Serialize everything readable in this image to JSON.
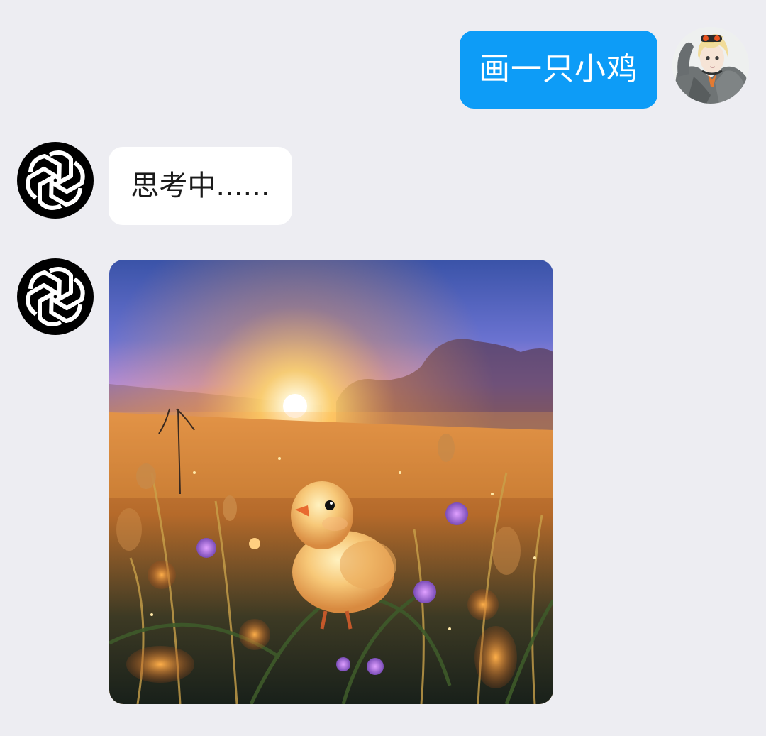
{
  "conversation": {
    "user_message": {
      "text": "画一只小鸡",
      "avatar_icon": "anime-character-avatar-icon"
    },
    "bot_messages": [
      {
        "text": "思考中......",
        "avatar_icon": "openai-logo-icon"
      },
      {
        "image_description_icon": "generated-chick-image",
        "avatar_icon": "openai-logo-icon"
      }
    ]
  },
  "colors": {
    "background": "#ededf2",
    "user_bubble": "#0d9cf7",
    "bot_bubble": "#ffffff",
    "avatar_bg": "#000000"
  }
}
